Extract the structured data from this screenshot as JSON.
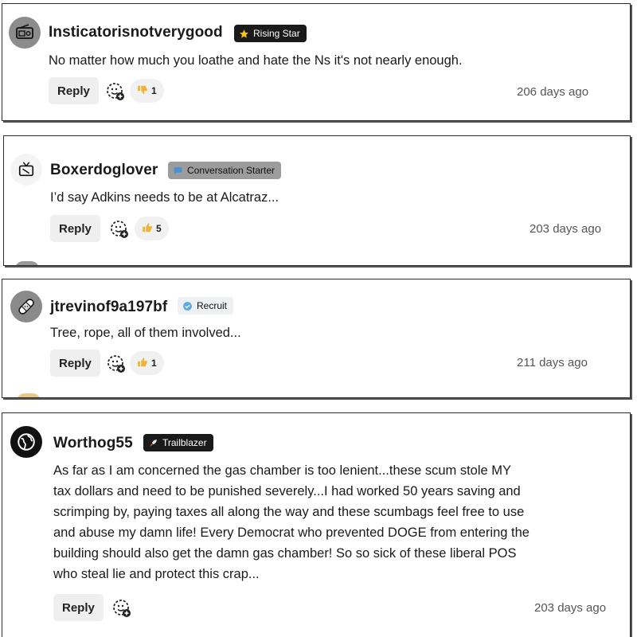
{
  "comments": [
    {
      "username": "Insticatorisnotverygood",
      "badge": {
        "label": "Rising Star",
        "icon": "star-icon"
      },
      "avatar": "radio-icon",
      "text": "No matter how much you loathe and hate the Ns it's not nearly enough.",
      "reply_label": "Reply",
      "vote": {
        "icon": "thumbs-down-icon",
        "count": "1"
      },
      "timestamp": "206 days ago"
    },
    {
      "username": "Boxerdoglover",
      "badge": {
        "label": "Conversation Starter",
        "icon": "speech-bubble-icon"
      },
      "avatar": "tv-icon",
      "text": "I’d say Adkins needs to be at Alcatraz...",
      "reply_label": "Reply",
      "vote": {
        "icon": "thumbs-up-icon",
        "count": "5"
      },
      "timestamp": "203 days ago"
    },
    {
      "username": "jtrevinof9a197bf",
      "badge": {
        "label": "Recruit",
        "icon": "verified-check-icon"
      },
      "avatar": "bandage-icon",
      "text": "Tree, rope, all of them involved...",
      "reply_label": "Reply",
      "vote": {
        "icon": "thumbs-up-icon",
        "count": "1"
      },
      "timestamp": "211 days ago"
    },
    {
      "username": "Worthog55",
      "badge": {
        "label": "Trailblazer",
        "icon": "rocket-icon"
      },
      "avatar": "globe-icon",
      "text_lines": [
        "As far as I am concerned the gas chamber is too lenient...these scum stole MY",
        "tax dollars and need to be punished severely...I had worked 50 years saving and",
        "scrimping by, paying taxes all along the way and these scumbags feel free to use",
        "and abuse my damn life! Every Democrat who prevented DOGE from entering the",
        "building should also get the damn gas chamber! So so sick of these liberal POS",
        "who steal lie and protect this crap..."
      ],
      "reply_label": "Reply",
      "timestamp": "203 days ago"
    }
  ],
  "colors": {
    "badge_dark": "#1a1a1a",
    "badge_gray": "#9c9c9c",
    "badge_light": "#eef0f2",
    "thumb": "#f2b233",
    "card_border": "#2b2b2b"
  }
}
